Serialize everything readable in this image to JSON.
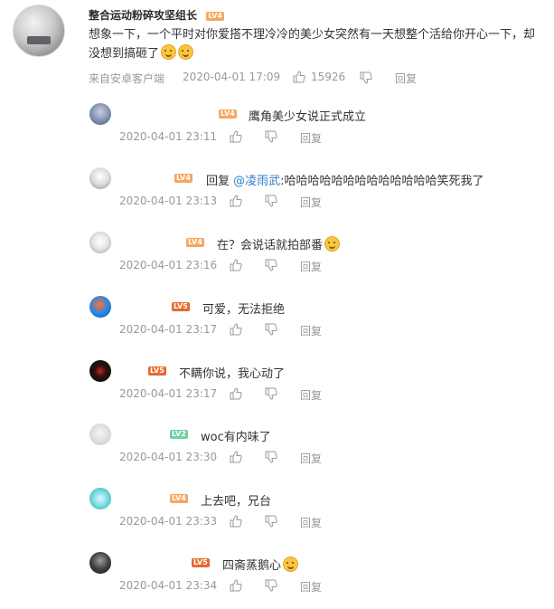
{
  "main_comment": {
    "username": "整合运动粉碎攻坚组长",
    "level": "LV4",
    "text": "想象一下，一个平时对你爱搭不理冷冷的美少女突然有一天想整个活给你开心一下，却没想到搞砸了",
    "source": "来自安卓客户端",
    "timestamp": "2020-04-01 17:09",
    "likes": "15926",
    "reply_label": "回复"
  },
  "replies": [
    {
      "level": "LV4",
      "pre": "",
      "mention": "",
      "text": "鹰角美少女说正式成立",
      "time": "2020-04-01 23:11",
      "reply_label": "回复"
    },
    {
      "level": "LV4",
      "pre": "回复 ",
      "mention": "@凌雨武",
      "text": ":哈哈哈哈哈哈哈哈哈哈哈哈哈笑死我了",
      "time": "2020-04-01 23:13",
      "reply_label": "回复"
    },
    {
      "level": "LV4",
      "pre": "",
      "mention": "",
      "text": "在？会说话就拍部番",
      "time": "2020-04-01 23:16",
      "reply_label": "回复"
    },
    {
      "level": "LV5",
      "pre": "",
      "mention": "",
      "text": "可爱，无法拒绝",
      "time": "2020-04-01 23:17",
      "reply_label": "回复"
    },
    {
      "level": "LV5",
      "pre": "",
      "mention": "",
      "text": "不瞒你说，我心动了",
      "time": "2020-04-01 23:17",
      "reply_label": "回复"
    },
    {
      "level": "LV2",
      "pre": "",
      "mention": "",
      "text": "woc有内味了",
      "time": "2020-04-01 23:30",
      "reply_label": "回复"
    },
    {
      "level": "LV4",
      "pre": "",
      "mention": "",
      "text": "上去吧，兄台",
      "time": "2020-04-01 23:33",
      "reply_label": "回复"
    },
    {
      "level": "LV5",
      "pre": "",
      "mention": "",
      "text": "四斋蒸鹅心",
      "time": "2020-04-01 23:34",
      "reply_label": "回复"
    }
  ],
  "colors": {
    "accent": "#eb7350",
    "link": "#2f7fc8",
    "meta": "#999999",
    "lv4": "#f6a760",
    "lv5": "#e8692d",
    "lv2": "#72d0a3"
  }
}
